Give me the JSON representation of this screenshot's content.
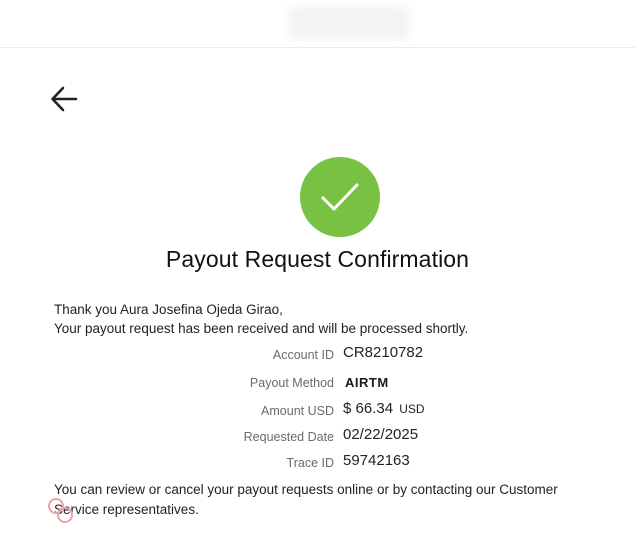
{
  "header": {
    "back_icon": "arrow-left-icon"
  },
  "confirmation": {
    "status_icon": "check-circle-icon",
    "status_color": "#79c142",
    "title": "Payout Request Confirmation",
    "greeting": "Thank you Aura Josefina Ojeda Girao,",
    "message": "Your payout request has been received and will be processed shortly."
  },
  "details": {
    "account_id_label": "Account ID",
    "account_id_value": "CR8210782",
    "payout_method_label": "Payout Method",
    "payout_method_value": "AIRTM",
    "amount_label": "Amount USD",
    "amount_value": "$ 66.34",
    "amount_currency": "USD",
    "requested_date_label": "Requested Date",
    "requested_date_value": "02/22/2025",
    "trace_id_label": "Trace ID",
    "trace_id_value": "59742163"
  },
  "footer": {
    "text": "You can review or cancel your payout requests online or by contacting our Customer Service representatives."
  }
}
